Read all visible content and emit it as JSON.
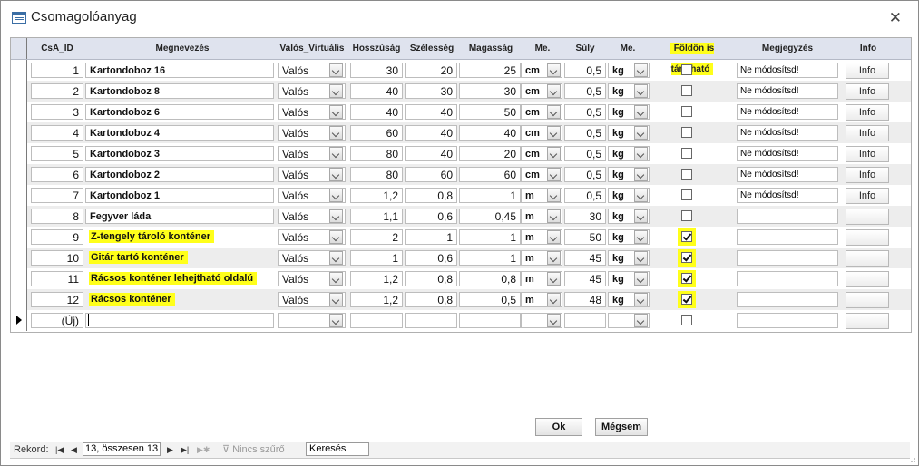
{
  "window": {
    "title": "Csomagolóanyag",
    "close": "✕"
  },
  "columns": [
    {
      "label": "CsA_ID"
    },
    {
      "label": "Megnevezés"
    },
    {
      "label": "Valós_Virtuális"
    },
    {
      "label": "Hosszúság"
    },
    {
      "label": "Szélesség"
    },
    {
      "label": "Magasság"
    },
    {
      "label": "Me."
    },
    {
      "label": "Súly"
    },
    {
      "label": "Me."
    },
    {
      "label": "Földön is tárolható",
      "highlight": true
    },
    {
      "label": "Megjegyzés"
    },
    {
      "label": "Info"
    }
  ],
  "rows": [
    {
      "id": "1",
      "name": "Kartondoboz 16",
      "type": "Valós",
      "length": "30",
      "width": "20",
      "height": "25",
      "unit": "cm",
      "weight": "0,5",
      "wunit": "kg",
      "floor": false,
      "note": "Ne módosítsd!",
      "info": "Info"
    },
    {
      "id": "2",
      "name": "Kartondoboz 8",
      "type": "Valós",
      "length": "40",
      "width": "30",
      "height": "30",
      "unit": "cm",
      "weight": "0,5",
      "wunit": "kg",
      "floor": false,
      "note": "Ne módosítsd!",
      "info": "Info"
    },
    {
      "id": "3",
      "name": "Kartondoboz 6",
      "type": "Valós",
      "length": "40",
      "width": "40",
      "height": "50",
      "unit": "cm",
      "weight": "0,5",
      "wunit": "kg",
      "floor": false,
      "note": "Ne módosítsd!",
      "info": "Info"
    },
    {
      "id": "4",
      "name": "Kartondoboz 4",
      "type": "Valós",
      "length": "60",
      "width": "40",
      "height": "40",
      "unit": "cm",
      "weight": "0,5",
      "wunit": "kg",
      "floor": false,
      "note": "Ne módosítsd!",
      "info": "Info"
    },
    {
      "id": "5",
      "name": "Kartondoboz 3",
      "type": "Valós",
      "length": "80",
      "width": "40",
      "height": "20",
      "unit": "cm",
      "weight": "0,5",
      "wunit": "kg",
      "floor": false,
      "note": "Ne módosítsd!",
      "info": "Info"
    },
    {
      "id": "6",
      "name": "Kartondoboz 2",
      "type": "Valós",
      "length": "80",
      "width": "60",
      "height": "60",
      "unit": "cm",
      "weight": "0,5",
      "wunit": "kg",
      "floor": false,
      "note": "Ne módosítsd!",
      "info": "Info"
    },
    {
      "id": "7",
      "name": "Kartondoboz 1",
      "type": "Valós",
      "length": "1,2",
      "width": "0,8",
      "height": "1",
      "unit": "m",
      "weight": "0,5",
      "wunit": "kg",
      "floor": false,
      "note": "Ne módosítsd!",
      "info": "Info"
    },
    {
      "id": "8",
      "name": "Fegyver láda",
      "type": "Valós",
      "length": "1,1",
      "width": "0,6",
      "height": "0,45",
      "unit": "m",
      "weight": "30",
      "wunit": "kg",
      "floor": false,
      "note": "",
      "info": ""
    },
    {
      "id": "9",
      "name": "Z-tengely tároló konténer",
      "highlight": true,
      "type": "Valós",
      "length": "2",
      "width": "1",
      "height": "1",
      "unit": "m",
      "weight": "50",
      "wunit": "kg",
      "floor": true,
      "note": "",
      "info": ""
    },
    {
      "id": "10",
      "name": "Gitár tartó konténer",
      "highlight": true,
      "type": "Valós",
      "length": "1",
      "width": "0,6",
      "height": "1",
      "unit": "m",
      "weight": "45",
      "wunit": "kg",
      "floor": true,
      "note": "",
      "info": ""
    },
    {
      "id": "11",
      "name": "Rácsos konténer lehejtható oldalú",
      "highlight": true,
      "type": "Valós",
      "length": "1,2",
      "width": "0,8",
      "height": "0,8",
      "unit": "m",
      "weight": "45",
      "wunit": "kg",
      "floor": true,
      "note": "",
      "info": ""
    },
    {
      "id": "12",
      "name": "Rácsos konténer",
      "highlight": true,
      "type": "Valós",
      "length": "1,2",
      "width": "0,8",
      "height": "0,5",
      "unit": "m",
      "weight": "48",
      "wunit": "kg",
      "floor": true,
      "note": "",
      "info": ""
    }
  ],
  "new_row": {
    "id": "(Új)"
  },
  "buttons": {
    "ok": "Ok",
    "cancel": "Mégsem"
  },
  "status": {
    "record_label": "Rekord:",
    "record_value": "13, összesen 13",
    "filter": "Nincs szűrő",
    "search": "Keresés"
  },
  "colors": {
    "highlight": "#ffff1a",
    "header": "#dfe3ee"
  }
}
